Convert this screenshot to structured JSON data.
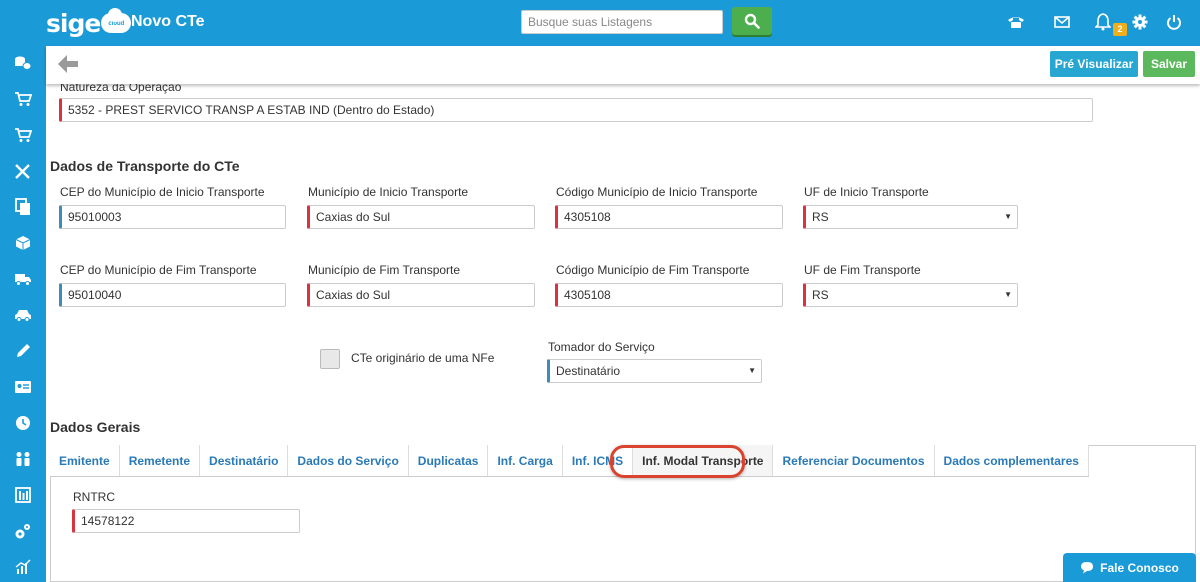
{
  "header": {
    "logo": "sige",
    "logo_sub": "cloud",
    "title": "Novo CTe",
    "search_placeholder": "Busque suas Listagens",
    "notification_count": "2"
  },
  "toolbar": {
    "preview_label": "Pré Visualizar",
    "save_label": "Salvar"
  },
  "natureza": {
    "label": "Natureza da Operação",
    "value": "5352 - PREST SERVICO TRANSP A ESTAB IND (Dentro do Estado)"
  },
  "transporte": {
    "title": "Dados de Transporte do CTe",
    "cep_inicio": {
      "label": "CEP do Município de Inicio Transporte",
      "value": "95010003"
    },
    "mun_inicio": {
      "label": "Município de Inicio Transporte",
      "value": "Caxias do Sul"
    },
    "cod_inicio": {
      "label": "Código Município de Inicio Transporte",
      "value": "4305108"
    },
    "uf_inicio": {
      "label": "UF de Inicio Transporte",
      "value": "RS"
    },
    "cep_fim": {
      "label": "CEP do Município de Fim Transporte",
      "value": "95010040"
    },
    "mun_fim": {
      "label": "Município de Fim Transporte",
      "value": "Caxias do Sul"
    },
    "cod_fim": {
      "label": "Código Município de Fim Transporte",
      "value": "4305108"
    },
    "uf_fim": {
      "label": "UF de Fim Transporte",
      "value": "RS"
    },
    "cte_nfe_label": "CTe originário de uma NFe",
    "tomador": {
      "label": "Tomador do Serviço",
      "value": "Destinatário"
    }
  },
  "gerais": {
    "title": "Dados Gerais",
    "tabs": [
      "Emitente",
      "Remetente",
      "Destinatário",
      "Dados do Serviço",
      "Duplicatas",
      "Inf. Carga",
      "Inf. ICMS",
      "Inf. Modal Transporte",
      "Referenciar Documentos",
      "Dados complementares"
    ],
    "active_tab": "Inf. Modal Transporte",
    "rntrc": {
      "label": "RNTRC",
      "value": "14578122"
    }
  },
  "chat": {
    "label": "Fale Conosco"
  },
  "colors": {
    "brand": "#1a9bd7",
    "required": "#d9333f",
    "optional": "#3c8dbc",
    "save": "#5cb85c",
    "highlight": "#d9432f"
  }
}
